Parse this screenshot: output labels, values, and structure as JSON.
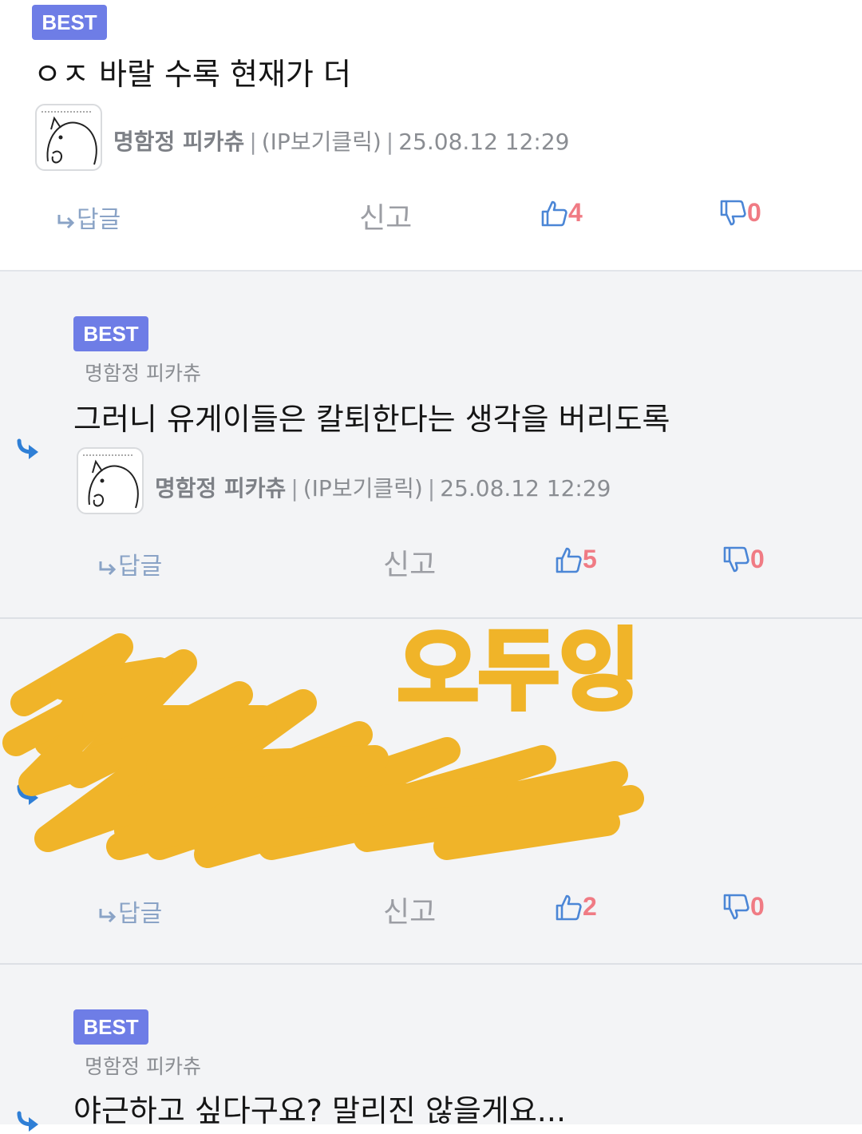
{
  "comments": [
    {
      "badge": "BEST",
      "text": "ㅇㅈ 바랄 수록 현재가 더",
      "author": "명함정 피카츄",
      "ip": "(IP보기클릭)",
      "date": "25.08.12 12:29",
      "reply_label": "답글",
      "report_label": "신고",
      "likes": "4",
      "dislikes": "0"
    },
    {
      "badge": "BEST",
      "parent_author": "명함정 피카츄",
      "text": "그러니 유게이들은 칼퇴한다는 생각을 버리도록",
      "author": "명함정 피카츄",
      "ip": "(IP보기클릭)",
      "date": "25.08.12 12:29",
      "reply_label": "답글",
      "report_label": "신고",
      "likes": "5",
      "dislikes": "0"
    },
    {
      "overlay_text": "오두잉",
      "reply_label": "답글",
      "report_label": "신고",
      "likes": "2",
      "dislikes": "0"
    },
    {
      "badge": "BEST",
      "parent_author": "명함정 피카츄",
      "text": "야근하고 싶다구요? 말리진 않을게요..."
    }
  ],
  "colors": {
    "badge": "#6e7de6",
    "count": "#f07b84",
    "reply_arrow": "#2f7fd6",
    "scribble": "#f0b429"
  },
  "icons": [
    "reply-arrow-icon",
    "thumbs-up-icon",
    "thumbs-down-icon",
    "avatar-cat-sketch"
  ]
}
